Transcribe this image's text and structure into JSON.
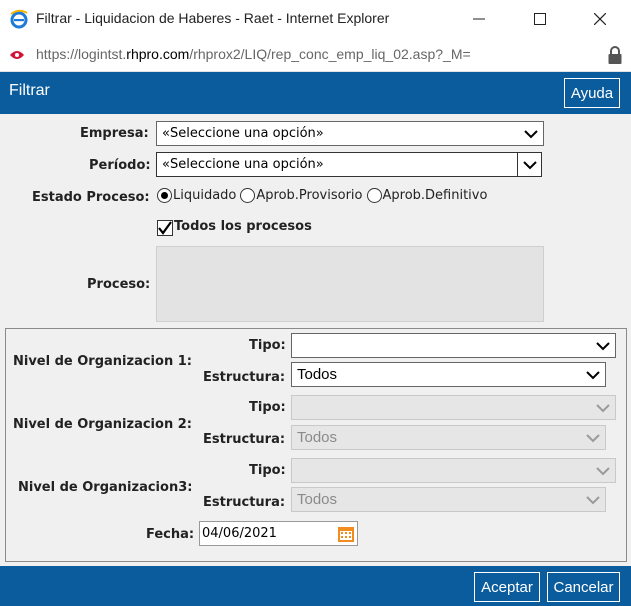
{
  "window": {
    "title": "Filtrar - Liquidacion de Haberes - Raet - Internet Explorer",
    "url_prefix": "https://logintst.",
    "url_domain": "rhpro.com",
    "url_path": "/rhprox2/LIQ/rep_conc_emp_liq_02.asp?_M="
  },
  "header": {
    "title": "Filtrar",
    "help_label": "Ayuda"
  },
  "form": {
    "empresa_label": "Empresa:",
    "empresa_value": "«Seleccione una opción»",
    "periodo_label": "Período:",
    "periodo_value": "«Seleccione una opción»",
    "estado_label": "Estado Proceso:",
    "estado_options": [
      "Liquidado",
      "Aprob.Provisorio",
      "Aprob.Definitivo"
    ],
    "estado_selected": "Liquidado",
    "todos_label": "Todos los procesos",
    "todos_checked": true,
    "proceso_label": "Proceso:"
  },
  "org": {
    "tipo_label": "Tipo:",
    "estructura_label": "Estructura:",
    "levels": [
      {
        "label": "Nivel de Organizacion 1:",
        "tipo_value": "",
        "estructura_value": "Todos",
        "enabled": true
      },
      {
        "label": "Nivel de Organizacion 2:",
        "tipo_value": "",
        "estructura_value": "Todos",
        "enabled": false
      },
      {
        "label": "Nivel de Organizacion3:",
        "tipo_value": "",
        "estructura_value": "Todos",
        "enabled": false
      }
    ],
    "fecha_label": "Fecha:",
    "fecha_value": "04/06/2021"
  },
  "footer": {
    "accept_label": "Aceptar",
    "cancel_label": "Cancelar"
  },
  "colors": {
    "accent": "#0b5c9c",
    "panel_bg": "#f0f0f0",
    "calendar": "#f28c1e"
  },
  "icons": [
    "ie-logo-icon",
    "minimize-icon",
    "maximize-icon",
    "close-icon",
    "site-favicon-icon",
    "lock-icon",
    "chevron-down-icon",
    "calendar-icon"
  ]
}
